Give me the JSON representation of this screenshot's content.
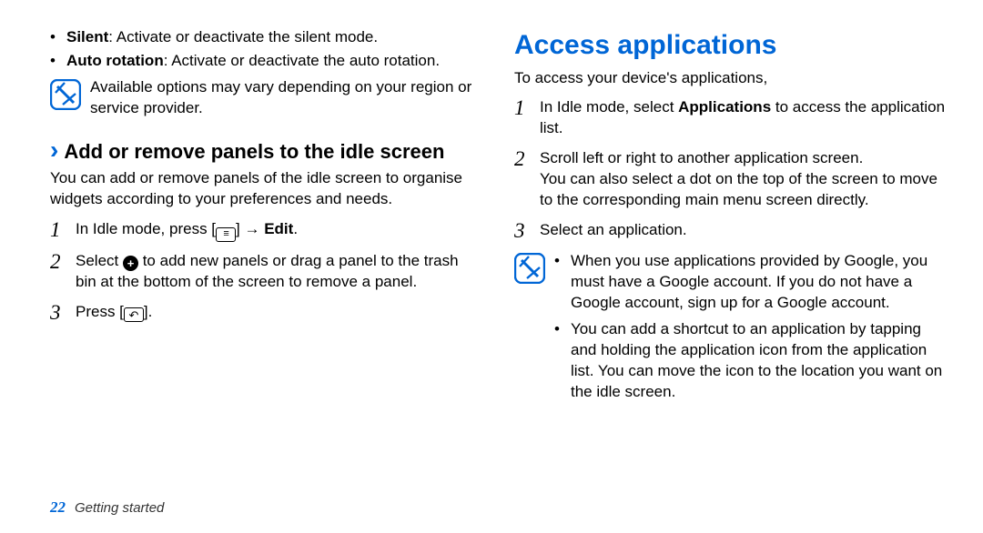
{
  "left": {
    "bullets": [
      {
        "bold": "Silent",
        "rest": ": Activate or deactivate the silent mode."
      },
      {
        "bold": "Auto rotation",
        "rest": ": Activate or deactivate the auto rotation."
      }
    ],
    "note": "Available options may vary depending on your region or service provider.",
    "section": {
      "chevron": "›",
      "title": "Add or remove panels to the idle screen",
      "intro": "You can add or remove panels of the idle screen to organise widgets according to your preferences and needs.",
      "steps": {
        "s1": {
          "num": "1",
          "pre": "In Idle mode, press [",
          "mid": "] → ",
          "bold": "Edit",
          "post": "."
        },
        "s2": {
          "num": "2",
          "pre": "Select ",
          "plus": "+",
          "post": " to add new panels or drag a panel to the trash bin at the bottom of the screen to remove a panel."
        },
        "s3": {
          "num": "3",
          "pre": "Press [",
          "post": "]."
        }
      }
    }
  },
  "right": {
    "heading": "Access applications",
    "intro": "To access your device's applications,",
    "steps": {
      "s1": {
        "num": "1",
        "pre": "In Idle mode, select ",
        "bold": "Applications",
        "post": " to access the application list."
      },
      "s2": {
        "num": "2",
        "line1": "Scroll left or right to another application screen.",
        "line2": "You can also select a dot on the top of the screen to move to the corresponding main menu screen directly."
      },
      "s3": {
        "num": "3",
        "text": "Select an application."
      }
    },
    "note": {
      "b1": "When you use applications provided by Google, you must have a Google account. If you do not have a Google account, sign up for a Google account.",
      "b2": "You can add a shortcut to an application by tapping and holding the application icon from the application list. You can move the icon to the location you want on the idle screen."
    }
  },
  "footer": {
    "page": "22",
    "section": "Getting started"
  },
  "glyphs": {
    "bullet": "•",
    "menu": "≡",
    "back": "↶"
  }
}
